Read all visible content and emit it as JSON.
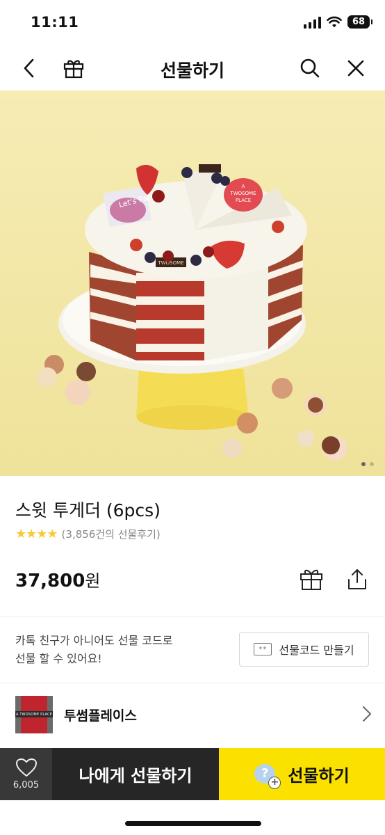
{
  "status": {
    "time": "11:11",
    "battery": "68"
  },
  "nav": {
    "title": "선물하기"
  },
  "carousel": {
    "page_count": 2,
    "active_index": 0
  },
  "product": {
    "name": "스윗 투게더 (6pcs)",
    "rating_stars": 4,
    "review_count": "(3,856건의 선물후기)",
    "price": "37,800",
    "price_unit": "원"
  },
  "gift_code": {
    "description_line1": "카톡 친구가 아니어도 선물 코드로",
    "description_line2": "선물 할 수 있어요!",
    "button_label": "선물코드 만들기",
    "icon_text": "**"
  },
  "brand": {
    "name": "투썸플레이스",
    "logo_text": "A TWOSOME PLACE"
  },
  "bottom_bar": {
    "like_count": "6,005",
    "buy_self_label": "나에게 선물하기",
    "gift_label": "선물하기",
    "gift_badge_text": "?",
    "gift_badge_plus": "+"
  },
  "cake": {
    "topper_party": "Let's Party",
    "topper_brand_line1": "A",
    "topper_brand_line2": "TWOSOME",
    "topper_brand_line3": "PLACE",
    "plaque_text": "TWOSOME"
  },
  "colors": {
    "kakao_yellow": "#fae100",
    "dark_button": "#262626",
    "star": "#f7c933",
    "hero_background": "#f3e8a6"
  }
}
